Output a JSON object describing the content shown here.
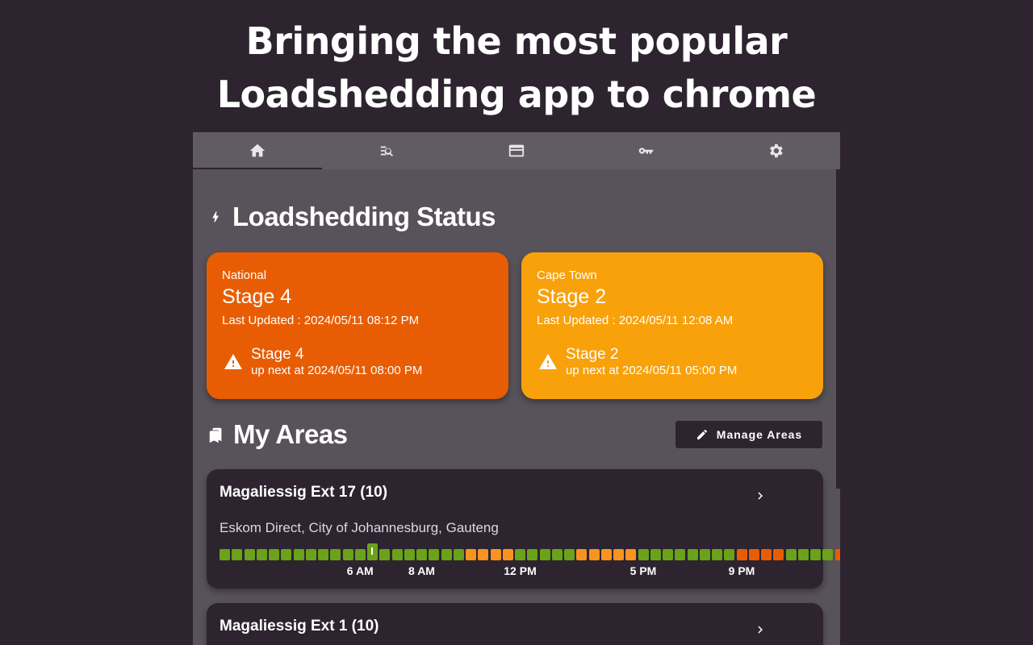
{
  "hero": {
    "line1": "Bringing the most popular",
    "line2": "Loadshedding app to chrome"
  },
  "tabs": [
    {
      "icon": "home-icon",
      "active": true
    },
    {
      "icon": "search-list-icon",
      "active": false
    },
    {
      "icon": "wallet-icon",
      "active": false
    },
    {
      "icon": "key-icon",
      "active": false
    },
    {
      "icon": "gear-icon",
      "active": false
    }
  ],
  "status": {
    "title": "Loadshedding Status",
    "cards": [
      {
        "region": "National",
        "stage": "Stage 4",
        "updated": "Last Updated : 2024/05/11 08:12 PM",
        "next_stage": "Stage 4",
        "next_time": "up next at 2024/05/11 08:00 PM",
        "color": "#e85d04"
      },
      {
        "region": "Cape Town",
        "stage": "Stage 2",
        "updated": "Last Updated : 2024/05/11 12:08 AM",
        "next_stage": "Stage 2",
        "next_time": "up next at 2024/05/11 05:00 PM",
        "color": "#f8a10a"
      }
    ]
  },
  "areas": {
    "title": "My Areas",
    "manage_label": "Manage Areas",
    "list": [
      {
        "name": "Magaliessig Ext 17 (10)",
        "subtitle": "Eskom Direct, City of Johannesburg, Gauteng",
        "timeline": "ggggggggggggggggggggoooogggggoooooggggggggrrrrggggroooog",
        "now_index": 12,
        "ticks": [
          {
            "label": "6 AM",
            "slot": 11
          },
          {
            "label": "8 AM",
            "slot": 16
          },
          {
            "label": "12 PM",
            "slot": 24
          },
          {
            "label": "5 PM",
            "slot": 34
          },
          {
            "label": "9 PM",
            "slot": 42
          }
        ]
      },
      {
        "name": "Magaliessig Ext 1 (10)"
      }
    ]
  },
  "colors": {
    "green": "#6aa219",
    "orange": "#f7931e",
    "red": "#e85d04"
  }
}
